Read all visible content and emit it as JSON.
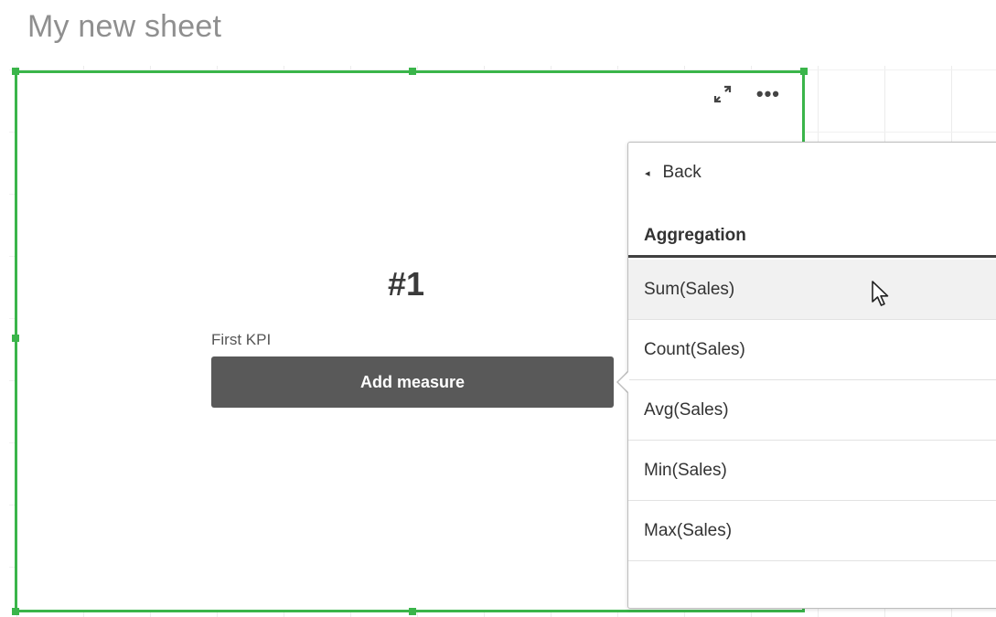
{
  "sheet": {
    "title": "My new sheet"
  },
  "kpi": {
    "value": "#1",
    "label": "First KPI",
    "add_measure_label": "Add measure",
    "toolbar": {
      "expand_icon": "expand-icon",
      "more_icon": "more-options-icon",
      "more_glyph": "•••"
    }
  },
  "popover": {
    "back_label": "Back",
    "back_icon": "◂",
    "section_title": "Aggregation",
    "items": [
      {
        "label": "Sum(Sales)",
        "hovered": true
      },
      {
        "label": "Count(Sales)",
        "hovered": false
      },
      {
        "label": "Avg(Sales)",
        "hovered": false
      },
      {
        "label": "Min(Sales)",
        "hovered": false
      },
      {
        "label": "Max(Sales)",
        "hovered": false
      }
    ]
  },
  "colors": {
    "selection": "#3ab54a",
    "button": "#595959",
    "title": "#8f8f8f"
  }
}
